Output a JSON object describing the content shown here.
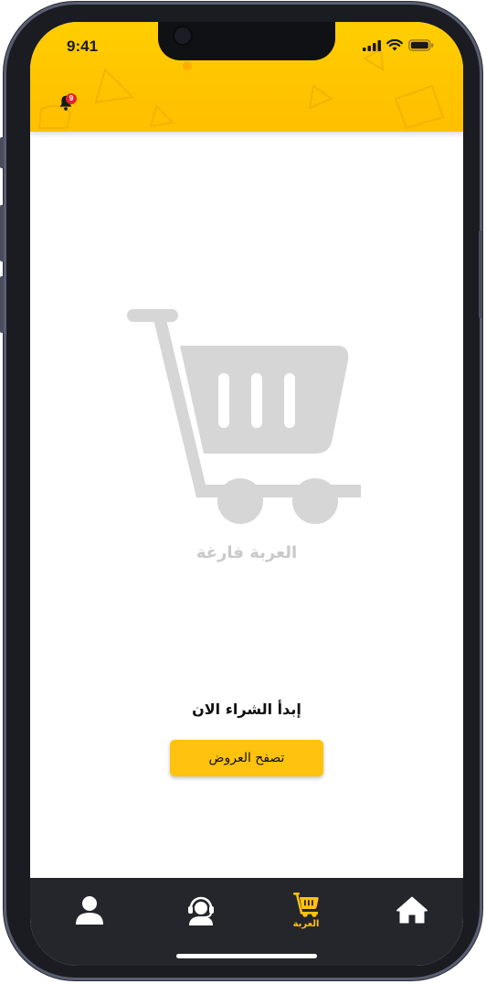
{
  "status_bar": {
    "time": "9:41"
  },
  "header": {
    "notification_count": "9"
  },
  "empty_cart": {
    "title": "العربة فارغة",
    "prompt": "إبدأ الشراء الان",
    "browse_button": "تصفح العروض"
  },
  "bottom_nav": {
    "items": [
      {
        "icon": "home-icon",
        "label": ""
      },
      {
        "icon": "cart-icon",
        "label": "العربة",
        "active": true
      },
      {
        "icon": "support-agent-icon",
        "label": ""
      },
      {
        "icon": "profile-icon",
        "label": ""
      }
    ]
  },
  "colors": {
    "accent": "#ffc20e",
    "header": "#ffc400",
    "nav_bg": "#25262b",
    "illustration": "#d6d6d6"
  }
}
